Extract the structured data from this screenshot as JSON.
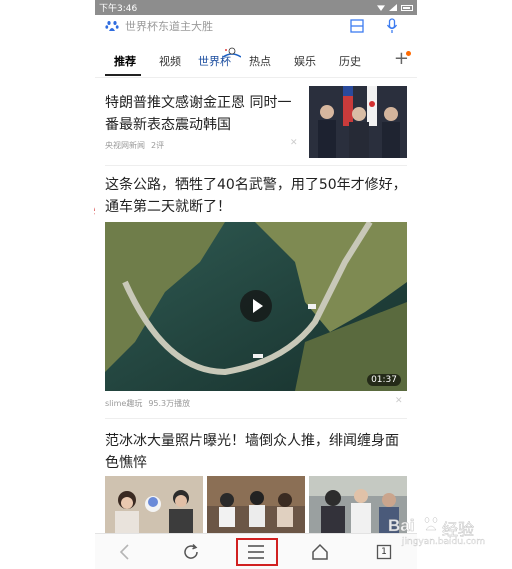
{
  "status_bar": {
    "time": "下午3:46"
  },
  "search": {
    "placeholder": "世界杯东道主大胜"
  },
  "tabs": [
    {
      "label": "推荐",
      "active": true
    },
    {
      "label": "视频"
    },
    {
      "label": "世界杯"
    },
    {
      "label": "热点"
    },
    {
      "label": "娱乐"
    },
    {
      "label": "历史"
    }
  ],
  "articles": [
    {
      "title": "特朗普推文感谢金正恩 同时一番最新表态震动韩国",
      "source": "央视网新闻",
      "comments": "2评"
    },
    {
      "title": "这条公路，牺牲了40名武警，用了50年才修好，通车第二天就断了！",
      "source": "slime趣玩",
      "plays": "95.3万播放",
      "duration": "01:37"
    },
    {
      "title": "范冰冰大量照片曝光！墙倒众人推，绯闻缠身面色憔悴"
    }
  ],
  "nav": {
    "tab_count": "1"
  },
  "watermark": {
    "brand": "Bai",
    "suffix": "经验",
    "url": "jingyan.baidu.com"
  },
  "colors": {
    "highlight": "#d12020",
    "notify_dot": "#ff6a00",
    "baidu_blue": "#2f6cdf"
  }
}
